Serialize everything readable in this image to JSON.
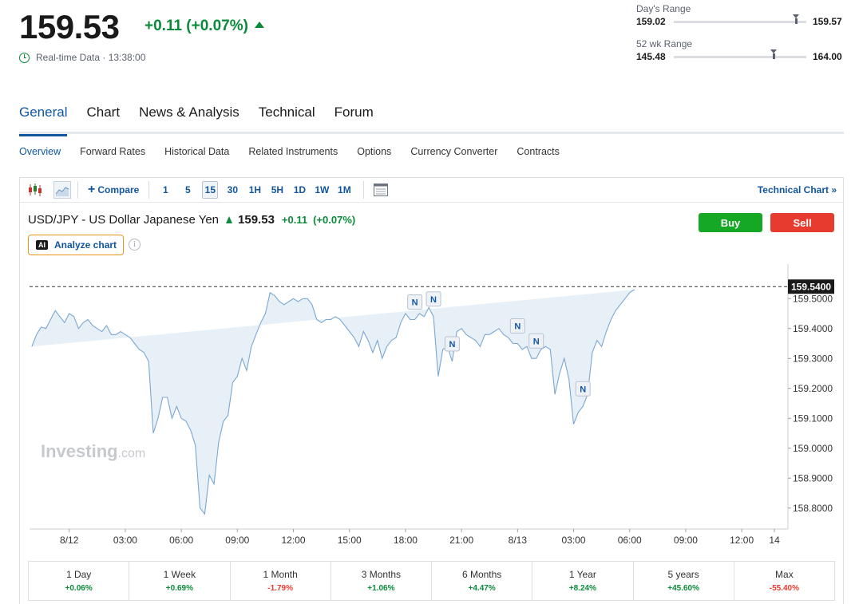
{
  "quote": {
    "price": "159.53",
    "change": "+0.11 (+0.07%)",
    "realtime": "Real-time Data · 13:38:00"
  },
  "ranges": [
    {
      "label": "Day's Range",
      "low": "159.02",
      "high": "159.57",
      "low_value": 159.02,
      "high_value": 159.57,
      "current": 159.53
    },
    {
      "label": "52 wk Range",
      "low": "145.48",
      "high": "164.00",
      "low_value": 145.48,
      "high_value": 164.0,
      "current": 159.53
    }
  ],
  "tabs": [
    "General",
    "Chart",
    "News & Analysis",
    "Technical",
    "Forum"
  ],
  "active_tab": "General",
  "subnav": [
    "Overview",
    "Forward Rates",
    "Historical Data",
    "Related Instruments",
    "Options",
    "Currency Converter",
    "Contracts"
  ],
  "active_subnav": "Overview",
  "toolbar": {
    "compare": "Compare",
    "resolutions": [
      "1",
      "5",
      "15",
      "30",
      "1H",
      "5H",
      "1D",
      "1W",
      "1M"
    ],
    "active_resolution": "15",
    "technical_chart": "Technical Chart »"
  },
  "instrument": {
    "name": "USD/JPY - US Dollar Japanese Yen",
    "price": "159.53",
    "change": "+0.11",
    "change_pct": "(+0.07%)",
    "analyze": "Analyze chart",
    "ai_badge": "AI",
    "buy": "Buy",
    "sell": "Sell"
  },
  "colors": {
    "accent": "#1256a0",
    "up": "#0a8a3a",
    "down": "#e83b2f",
    "line": "#7aa7d2",
    "area": "#e6eef6"
  },
  "watermark": {
    "main": "Investing",
    "suffix": ".com"
  },
  "chart_data": {
    "type": "area",
    "y_ticks": [
      "158.8000",
      "158.9000",
      "159.0000",
      "159.1000",
      "159.2000",
      "159.3000",
      "159.4000",
      "159.5000"
    ],
    "y_tick_values": [
      158.8,
      158.9,
      159.0,
      159.1,
      159.2,
      159.3,
      159.4,
      159.5
    ],
    "ylim": [
      158.73,
      159.61
    ],
    "current_label": "159.5400",
    "current_value": 159.54,
    "x_labels": [
      "8/12",
      "03:00",
      "06:00",
      "09:00",
      "12:00",
      "15:00",
      "18:00",
      "21:00",
      "8/13",
      "03:00",
      "06:00",
      "09:00",
      "12:00",
      "14"
    ],
    "x_label_pos": [
      0,
      12,
      24,
      36,
      48,
      60,
      72,
      84,
      96,
      108,
      120,
      132,
      144,
      151
    ],
    "xlim": [
      -8.5,
      151.5
    ],
    "x": [
      -8,
      -7,
      -6,
      -5,
      -4,
      -3,
      -2,
      -1,
      0,
      1,
      2,
      3,
      4,
      5,
      6,
      7,
      8,
      9,
      10,
      11,
      12,
      13,
      14,
      15,
      16,
      17,
      18,
      19,
      20,
      21,
      22,
      23,
      24,
      25,
      26,
      27,
      28,
      29,
      30,
      31,
      32,
      33,
      34,
      35,
      36,
      37,
      38,
      39,
      40,
      41,
      42,
      43,
      44,
      45,
      46,
      47,
      48,
      49,
      50,
      51,
      52,
      53,
      54,
      55,
      56,
      57,
      58,
      59,
      60,
      61,
      62,
      63,
      64,
      65,
      66,
      67,
      68,
      69,
      70,
      71,
      72,
      73,
      74,
      75,
      76,
      77,
      78,
      79,
      80,
      81,
      82,
      83,
      84,
      85,
      86,
      87,
      88,
      89,
      90,
      91,
      92,
      93,
      94,
      95,
      96,
      97,
      98,
      99,
      100,
      101,
      102,
      103,
      104,
      105,
      106,
      107,
      108,
      109,
      110,
      111,
      112,
      113,
      114,
      115,
      116,
      117,
      118,
      119,
      120,
      121,
      122,
      123,
      124,
      125,
      126,
      127,
      128,
      129,
      130,
      131,
      132,
      133,
      134,
      135,
      136,
      137,
      138,
      139,
      140,
      141,
      142,
      143,
      144,
      145,
      146,
      147,
      148,
      149,
      150
    ],
    "y": [
      159.34,
      159.38,
      159.405,
      159.4,
      159.43,
      159.46,
      159.44,
      159.42,
      159.45,
      159.44,
      159.4,
      159.42,
      159.43,
      159.41,
      159.4,
      159.39,
      159.41,
      159.38,
      159.38,
      159.39,
      159.38,
      159.37,
      159.35,
      159.33,
      159.32,
      159.29,
      159.05,
      159.1,
      159.17,
      159.17,
      159.1,
      159.14,
      159.1,
      159.09,
      159.06,
      159.01,
      158.8,
      158.78,
      158.91,
      158.88,
      159.02,
      159.09,
      159.11,
      159.22,
      159.24,
      159.3,
      159.26,
      159.34,
      159.38,
      159.42,
      159.45,
      159.52,
      159.51,
      159.49,
      159.48,
      159.49,
      159.5,
      159.49,
      159.5,
      159.5,
      159.48,
      159.43,
      159.42,
      159.43,
      159.43,
      159.44,
      159.43,
      159.41,
      159.39,
      159.37,
      159.34,
      159.39,
      159.36,
      159.32,
      159.36,
      159.3,
      159.34,
      159.36,
      159.37,
      159.42,
      159.45,
      159.43,
      159.43,
      159.45,
      159.44,
      159.47,
      159.44,
      159.24,
      159.33,
      159.34,
      159.29,
      159.39,
      159.4,
      159.38,
      159.37,
      159.36,
      159.34,
      159.38,
      159.38,
      159.39,
      159.4,
      159.38,
      159.37,
      159.35,
      159.35,
      159.33,
      159.34,
      159.3,
      159.3,
      159.33,
      159.34,
      159.33,
      159.18,
      159.25,
      159.3,
      159.23,
      159.08,
      159.12,
      159.14,
      159.18,
      159.32,
      159.36,
      159.34,
      159.39,
      159.43,
      159.46,
      159.48,
      159.5,
      159.52,
      159.53
    ],
    "news_markers": [
      {
        "x": 74,
        "label": "N"
      },
      {
        "x": 78,
        "label": "N"
      },
      {
        "x": 82,
        "label": "N"
      },
      {
        "x": 96,
        "label": "N"
      },
      {
        "x": 100,
        "label": "N"
      },
      {
        "x": 110,
        "label": "N"
      }
    ]
  },
  "performance": [
    {
      "label": "1 Day",
      "value": "+0.06%",
      "dir": "up"
    },
    {
      "label": "1 Week",
      "value": "+0.69%",
      "dir": "up"
    },
    {
      "label": "1 Month",
      "value": "-1.79%",
      "dir": "down"
    },
    {
      "label": "3 Months",
      "value": "+1.06%",
      "dir": "up"
    },
    {
      "label": "6 Months",
      "value": "+4.47%",
      "dir": "up"
    },
    {
      "label": "1 Year",
      "value": "+8.24%",
      "dir": "up"
    },
    {
      "label": "5 years",
      "value": "+45.60%",
      "dir": "up"
    },
    {
      "label": "Max",
      "value": "-55.40%",
      "dir": "down"
    }
  ]
}
